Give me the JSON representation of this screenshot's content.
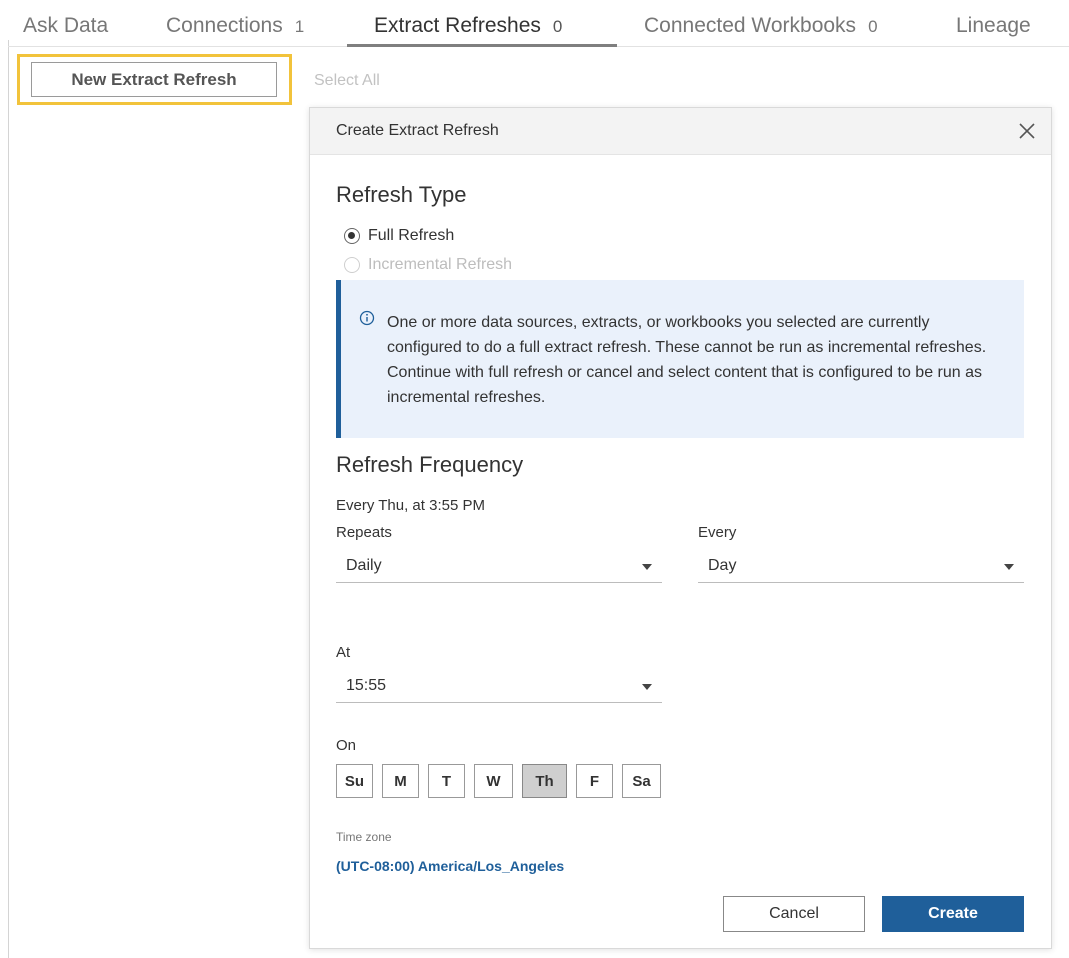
{
  "tabs": [
    {
      "label": "Ask Data",
      "count": ""
    },
    {
      "label": "Connections",
      "count": "1"
    },
    {
      "label": "Extract Refreshes",
      "count": "0"
    },
    {
      "label": "Connected Workbooks",
      "count": "0"
    },
    {
      "label": "Lineage",
      "count": ""
    }
  ],
  "active_tab": "Extract Refreshes",
  "toolbar": {
    "new_button_label": "New Extract Refresh",
    "select_all_label": "Select All"
  },
  "dialog": {
    "title": "Create Extract Refresh",
    "close_icon": "close-icon",
    "refresh_type": {
      "heading": "Refresh Type",
      "options": [
        {
          "label": "Full Refresh",
          "checked": true,
          "disabled": false
        },
        {
          "label": "Incremental Refresh",
          "checked": false,
          "disabled": true
        }
      ]
    },
    "info": {
      "icon": "info-icon",
      "text": "One or more data sources, extracts, or workbooks you selected are currently configured to do a full extract refresh. These cannot be run as incremental refreshes. Continue with full refresh or cancel and select content that is configured to be run as incremental refreshes."
    },
    "frequency": {
      "heading": "Refresh Frequency",
      "summary": "Every Thu, at 3:55 PM",
      "repeats_label": "Repeats",
      "repeats_value": "Daily",
      "every_label": "Every",
      "every_value": "Day",
      "at_label": "At",
      "at_value": "15:55",
      "on_label": "On",
      "days": [
        {
          "label": "Su",
          "selected": false
        },
        {
          "label": "M",
          "selected": false
        },
        {
          "label": "T",
          "selected": false
        },
        {
          "label": "W",
          "selected": false
        },
        {
          "label": "Th",
          "selected": true
        },
        {
          "label": "F",
          "selected": false
        },
        {
          "label": "Sa",
          "selected": false
        }
      ]
    },
    "timezone": {
      "label": "Time zone",
      "value": "(UTC-08:00) America/Los_Angeles"
    },
    "buttons": {
      "cancel": "Cancel",
      "create": "Create"
    }
  },
  "colors": {
    "accent": "#1f5f9a",
    "highlight": "#f2c33b",
    "info_bg": "#eaf1fb"
  }
}
